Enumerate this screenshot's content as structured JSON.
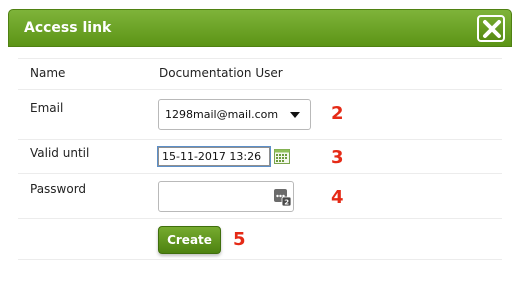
{
  "dialog": {
    "title": "Access link",
    "close_icon": "close-x-icon"
  },
  "form": {
    "name_label": "Name",
    "name_value": "Documentation User",
    "email_label": "Email",
    "email_selected": "1298mail@mail.com",
    "valid_until_label": "Valid until",
    "valid_until_value": "15-11-2017 13:26",
    "password_label": "Password",
    "password_value": "",
    "create_label": "Create"
  },
  "annotations": {
    "email_marker": "2",
    "valid_until_marker": "3",
    "password_marker": "4",
    "create_marker": "5"
  },
  "colors": {
    "accent": "#6aa223",
    "marker": "#e52a16"
  },
  "icons": {
    "calendar": "calendar-icon",
    "password_generator": "password-generator-icon",
    "dropdown": "chevron-down-icon"
  }
}
